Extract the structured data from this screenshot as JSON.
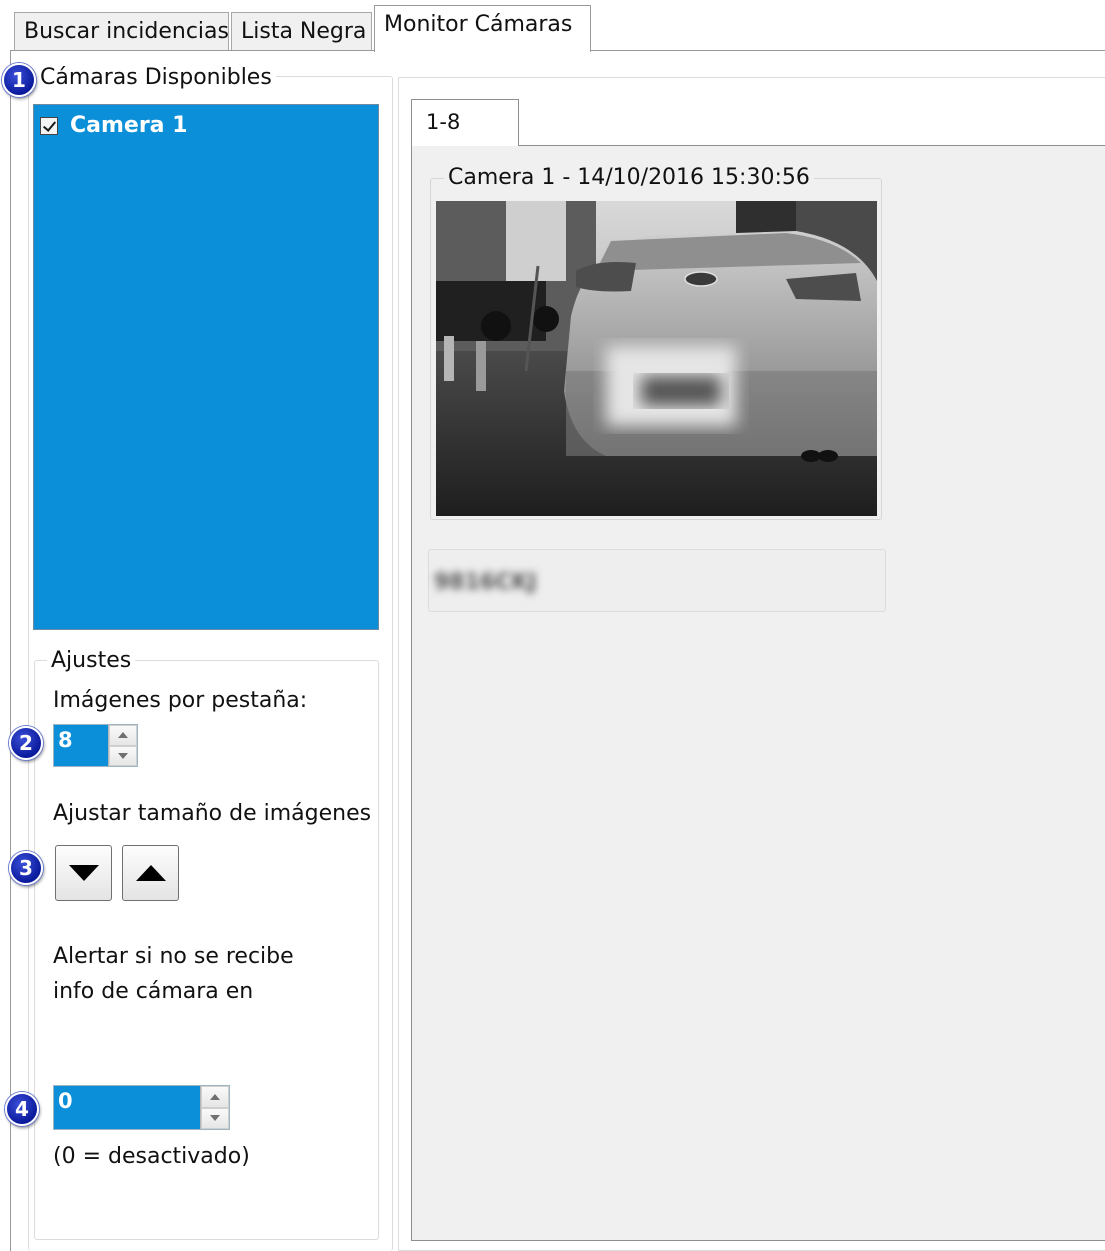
{
  "tabs": [
    {
      "label": "Buscar incidencias",
      "active": false
    },
    {
      "label": "Lista Negra",
      "active": false
    },
    {
      "label": "Monitor Cámaras",
      "active": true
    }
  ],
  "badges": [
    "1",
    "2",
    "3",
    "4"
  ],
  "available_cameras": {
    "title": "Cámaras Disponibles",
    "items": [
      {
        "label": "Camera 1",
        "checked": true
      }
    ]
  },
  "settings": {
    "title": "Ajustes",
    "images_per_tab_label": "Imágenes por pestaña:",
    "images_per_tab_value": "8",
    "resize_label": "Ajustar tamaño de imágenes",
    "alert_label_line1": "Alertar si no se recibe",
    "alert_label_line2": "info de cámara en",
    "alert_value": "0",
    "alert_note": "(0 = desactivado)"
  },
  "monitor": {
    "page_tab": "1-8",
    "camera_caption": "Camera 1 - 14/10/2016 15:30:56",
    "plate_text": "9816CKJ"
  },
  "colors": {
    "selection": "#0a8fd8",
    "badge": "#1a2bc0"
  },
  "icons": {
    "decrease": "triangle-down-icon",
    "increase": "triangle-up-icon"
  }
}
